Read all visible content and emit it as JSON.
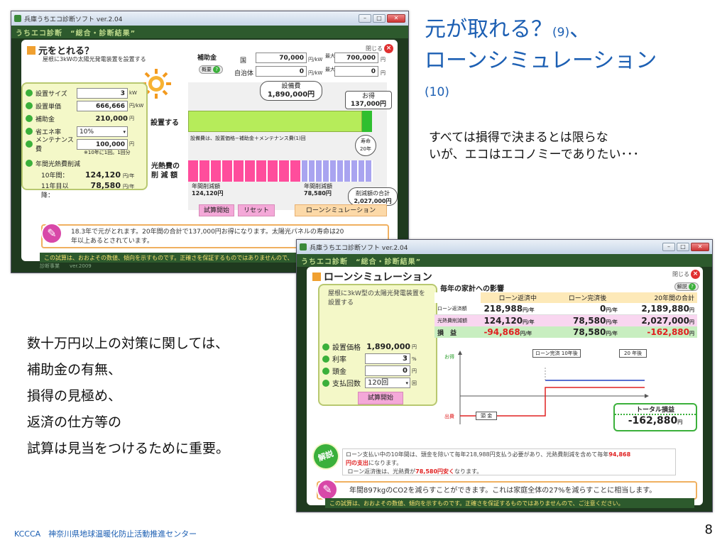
{
  "slide": {
    "title_line1": "元が取れる？",
    "title_num9": "(9)",
    "title_comma": "、",
    "title_line2": "ローンシミュレーション",
    "title_num10": "(10)",
    "body_line1": "すべては損得で決まるとは限らな",
    "body_line2": "いが、エコはエコノミーでありたい･･･",
    "list": [
      "数十万円以上の対策に関しては、",
      "補助金の有無、",
      "損得の見極め、",
      "返済の仕方等の",
      "試算は見当をつけるために重要。"
    ],
    "footer": "KCCCA　神奈川県地球温暖化防止活動推進センター",
    "page": "8"
  },
  "win1": {
    "titlebar": "兵庫うちエコ診断ソフト ver.2.04",
    "apphead": "うちエコ診断　“総合・診断結果”",
    "panel_title": "元をとれる？",
    "close": "閉じる",
    "desc": "屋根に3kWの太陽光発電装置を設置する",
    "subsidy_label": "補助金",
    "outline": "概要",
    "country": "国",
    "country_val": "70,000",
    "country_unit": "円/kW",
    "max": "最大",
    "max_country": "700,000",
    "local": "自治体",
    "local_val": "0",
    "max_local": "0",
    "yen": "円",
    "inputs": [
      {
        "label": "設置サイズ",
        "value": "3",
        "unit": "kW"
      },
      {
        "label": "設置単価",
        "value": "666,666",
        "unit": "円/kW"
      },
      {
        "label": "補助金",
        "value": "210,000",
        "unit": "円"
      },
      {
        "label": "省エネ率",
        "value": "10%",
        "unit": ""
      },
      {
        "label": "メンテナンス費",
        "value": "100,000",
        "unit": "円"
      }
    ],
    "maint_note": "※10年に1回。1回分",
    "annual_label": "年間光熱費削減",
    "y10_label": "10年間：",
    "y10_val": "124,120",
    "y11_label": "11年目以降：",
    "y11_val": "78,580",
    "per_year": "円/年",
    "equip_bubble": "設備費",
    "equip_val": "1,890,000円",
    "gain_bubble": "お得",
    "gain_val": "137,000円",
    "install_label": "設置する",
    "install_note": "設備費は、設置価格−補助金＋メンテナンス費(1)回",
    "life_label": "寿命",
    "life_val": "20年",
    "reduce_label_1": "光熱費の",
    "reduce_label_2": "削 減 額",
    "annual_reduce_a": "年間削減額",
    "annual_reduce_a_val": "124,120円",
    "annual_reduce_b": "年間削減額",
    "annual_reduce_b_val": "78,580円",
    "total_bubble": "削減額の合計",
    "total_val": "2,027,000円",
    "btn_start": "試算開始",
    "btn_reset": "リセット",
    "btn_loan": "ローンシミュレーション",
    "msg_line1": "18.3年で元がとれます。20年間の合計で137,000円お得になります。太陽光パネルの寿命は20",
    "msg_line2": "年以上あるとされています。",
    "footer_note": "この試算は、おおよその数値、傾向を示すものです。正確さを保証するものではありませんので、",
    "ver_note": "診断事業　　ver.2009"
  },
  "win2": {
    "titlebar": "兵庫うちエコ診断ソフト ver.2.04",
    "apphead": "うちエコ診断　“総合・診断結果”",
    "panel_title": "ローンシミュレーション",
    "close": "閉じる",
    "explain_btn": "解説",
    "desc": "屋根に3kW型の太陽光発電装置を設置する",
    "impact_title": "毎年の家計への影響",
    "table_head": [
      "",
      "ローン返済中",
      "ローン完済後",
      "20年間の合計"
    ],
    "table_rows": [
      {
        "label": "ローン返済額",
        "a": "218,988",
        "b": "0",
        "total": "2,189,880"
      },
      {
        "label": "光熱費削減額",
        "a": "124,120",
        "b": "78,580",
        "total": "2,027,000"
      },
      {
        "label": "損　益",
        "a": "-94,868",
        "b": "78,580",
        "total": "-162,880"
      }
    ],
    "yen": "円",
    "per_year": "円/年",
    "price_label": "設置価格",
    "price_val": "1,890,000",
    "rate_label": "利率",
    "rate_val": "3",
    "rate_unit": "%",
    "down_label": "頭金",
    "down_val": "0",
    "count_label": "支払回数",
    "count_val": "120回",
    "start_btn": "試算開始",
    "graph_gain": "お得",
    "graph_loss": "出費",
    "graph_loan_done": "ローン完済 10年後",
    "graph_20": "20 年後",
    "graph_down": "頭 金",
    "total_label": "トータル損益",
    "total_val": "-162,880",
    "explain_badge": "解説",
    "exp_line1a": "ローン支払い中の10年間は、頭金を除いて毎年218,988円支払う必要があり、光熱費削減を含めて毎年",
    "exp_red1": "94,868",
    "exp_line2red": "円の支出",
    "exp_line2": "になります。",
    "exp_line3a": "ローン返済後は、光熱費が",
    "exp_red3": "78,580円安く",
    "exp_line3b": "なります。",
    "co2_msg": "年間897kgのCO2を減らすことができます。これは家庭全体の27%を減らすことに相当します。",
    "footer_note": "この試算は、おおよその数値、傾向を示すものです。正確さを保証するものではありませんので、ご注意ください。"
  },
  "colors": {
    "title": "#1c5fb3",
    "green_bar": "#b6ec5a",
    "pink_bar": "#ff4d9c",
    "purple_bar": "#a9a4f0",
    "loss_red": "#e02020"
  }
}
